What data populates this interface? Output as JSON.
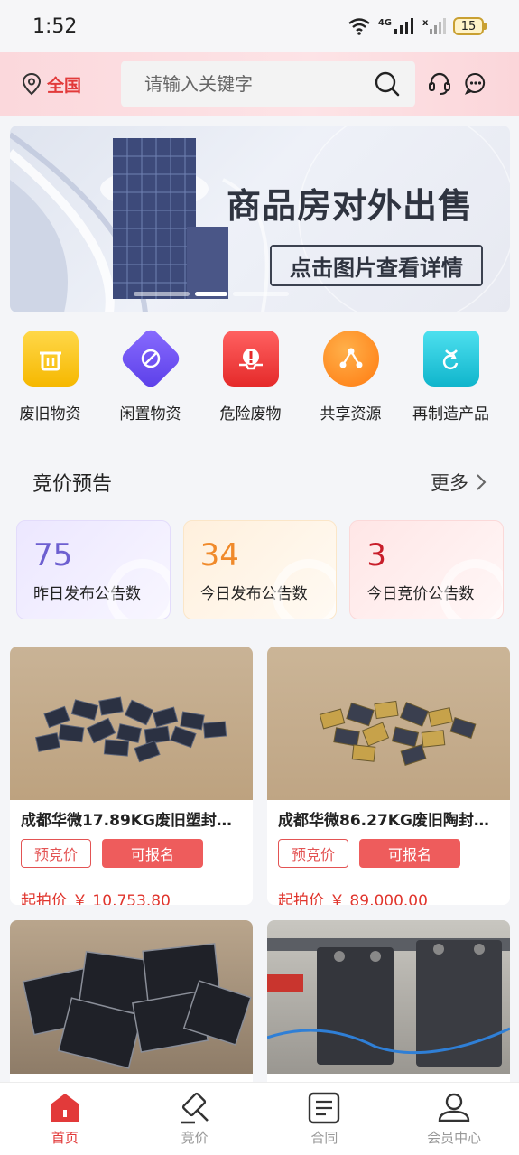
{
  "status_bar": {
    "time": "1:52",
    "network": "4G",
    "battery": "15"
  },
  "header": {
    "location": "全国",
    "search_placeholder": "请输入关键字"
  },
  "banner": {
    "title": "商品房对外出售",
    "subtitle": "点击图片查看详情",
    "slide_count": 3,
    "active_slide": 1
  },
  "categories": [
    {
      "label": "废旧物资",
      "icon": "box-trash-icon",
      "color": "#f6c200"
    },
    {
      "label": "闲置物资",
      "icon": "puzzle-icon",
      "color": "#6f52f0"
    },
    {
      "label": "危险废物",
      "icon": "warning-box-icon",
      "color": "#ef3b3b"
    },
    {
      "label": "共享资源",
      "icon": "share-icon",
      "color": "#ff8a1f"
    },
    {
      "label": "再制造产品",
      "icon": "refresh-bag-icon",
      "color": "#18c3d6"
    }
  ],
  "auction_notice": {
    "title": "竞价预告",
    "more": "更多"
  },
  "stats": [
    {
      "value": "75",
      "label": "昨日发布公告数"
    },
    {
      "value": "34",
      "label": "今日发布公告数"
    },
    {
      "value": "3",
      "label": "今日竞价公告数"
    }
  ],
  "products": [
    {
      "title": "成都华微17.89KG废旧塑封框…",
      "tag_pre": "预竞价",
      "tag_apply": "可报名",
      "price_label": "起拍价",
      "price": "￥ 10,753.80"
    },
    {
      "title": "成都华微86.27KG废旧陶封类…",
      "tag_pre": "预竞价",
      "tag_apply": "可报名",
      "price_label": "起拍价",
      "price": "￥ 89,000.00"
    }
  ],
  "tabbar": [
    {
      "label": "首页",
      "icon": "home-icon",
      "active": true
    },
    {
      "label": "竞价",
      "icon": "gavel-icon",
      "active": false
    },
    {
      "label": "合同",
      "icon": "document-icon",
      "active": false
    },
    {
      "label": "会员中心",
      "icon": "user-icon",
      "active": false
    }
  ],
  "colors": {
    "accent": "#e23a3a",
    "header_bg": "#fbd8dc"
  }
}
